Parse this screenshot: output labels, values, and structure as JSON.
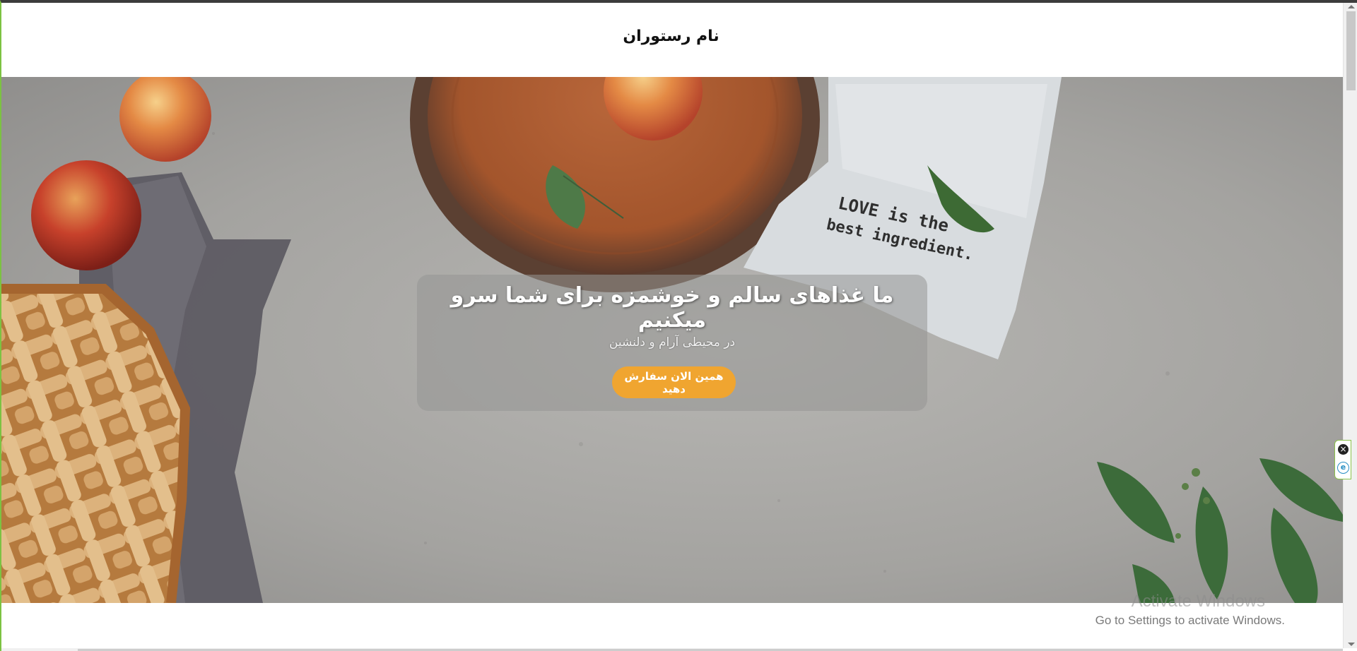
{
  "site": {
    "title": "نام رستوران"
  },
  "hero": {
    "heading": "ما غذاهای سالم و خوشمزه برای شما سرو میکنیم",
    "subheading": "در محیطی آرام و دلنشین",
    "cta_label": "همین الان سفارش دهید",
    "cta_color": "#f0a530",
    "image_description_icon": "food-photo"
  },
  "towel_text": {
    "line1": "LOVE is the",
    "line2": "best ingredient."
  },
  "windows_activation": {
    "line1": "Activate Windows",
    "line2": "Go to Settings to activate Windows."
  },
  "side_widget": {
    "close_icon": "close-icon",
    "extension_icon": "e-icon"
  }
}
